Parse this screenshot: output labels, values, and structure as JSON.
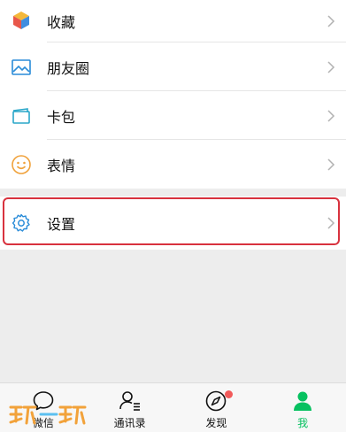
{
  "menu": {
    "items": [
      {
        "label": "收藏",
        "icon": "cube-icon"
      },
      {
        "label": "朋友圈",
        "icon": "image-icon"
      },
      {
        "label": "卡包",
        "icon": "card-icon"
      },
      {
        "label": "表情",
        "icon": "smiley-icon"
      },
      {
        "label": "设置",
        "icon": "gear-icon"
      }
    ]
  },
  "tabbar": {
    "tabs": [
      {
        "label": "微信",
        "icon": "chat-bubble-icon"
      },
      {
        "label": "通讯录",
        "icon": "contacts-icon"
      },
      {
        "label": "发现",
        "icon": "compass-icon",
        "badge": "red-dot"
      },
      {
        "label": "我",
        "icon": "person-icon",
        "active": true
      }
    ]
  },
  "watermark": {
    "text": "玩玩"
  },
  "colors": {
    "accent": "#07c160",
    "highlight_border": "#d8323e",
    "badge": "#f25a5a",
    "icon_blue": "#2a8cd8"
  }
}
